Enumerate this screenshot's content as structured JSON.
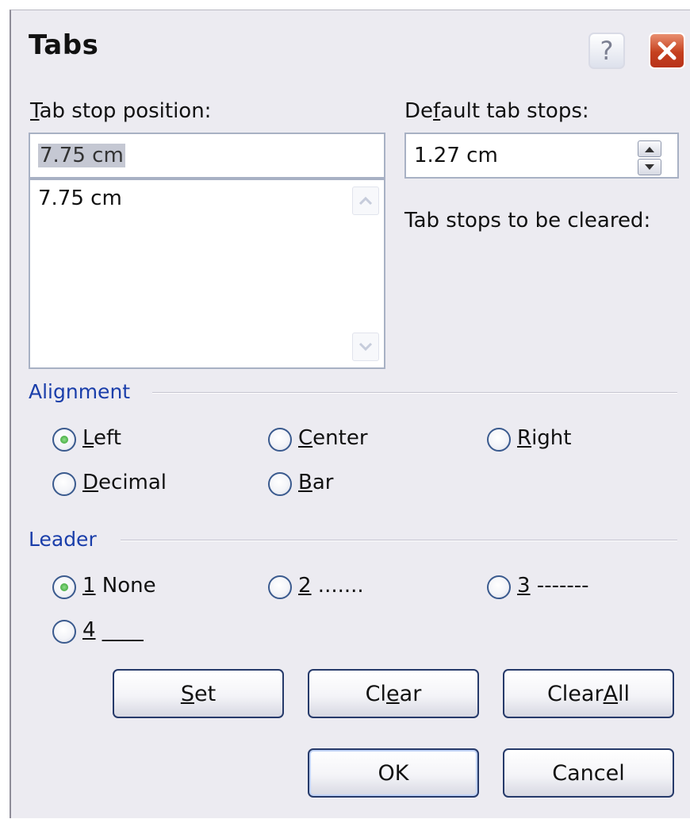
{
  "window": {
    "title": "Tabs",
    "help_label": "?"
  },
  "tab_stop": {
    "label_u": "T",
    "label_rest": "ab stop position:",
    "value": "7.75 cm",
    "list": [
      "7.75 cm"
    ]
  },
  "default_tabs": {
    "label_before": "De",
    "label_u": "f",
    "label_after": "ault tab stops:",
    "value": "1.27 cm"
  },
  "cleared": {
    "label": "Tab stops to be cleared:"
  },
  "alignment": {
    "title": "Alignment",
    "options": [
      {
        "u": "L",
        "rest": "eft",
        "checked": true
      },
      {
        "u": "C",
        "rest": "enter",
        "checked": false
      },
      {
        "u": "R",
        "rest": "ight",
        "checked": false
      },
      {
        "u": "D",
        "rest": "ecimal",
        "checked": false
      },
      {
        "u": "B",
        "rest": "ar",
        "checked": false
      }
    ]
  },
  "leader": {
    "title": "Leader",
    "options": [
      {
        "u": "1",
        "rest": " None",
        "checked": true
      },
      {
        "u": "2",
        "rest": " .......",
        "checked": false
      },
      {
        "u": "3",
        "rest": " -------",
        "checked": false
      },
      {
        "u": "4",
        "rest": " ____",
        "checked": false
      }
    ]
  },
  "buttons": {
    "set": {
      "u": "S",
      "rest": "et"
    },
    "clear": {
      "before": "Cl",
      "u": "e",
      "after": "ar"
    },
    "clear_all": {
      "before": "Clear ",
      "u": "A",
      "after": "ll"
    },
    "ok": "OK",
    "cancel": "Cancel"
  }
}
